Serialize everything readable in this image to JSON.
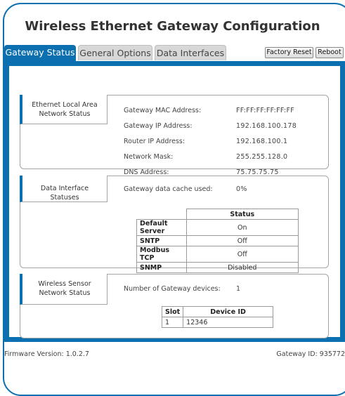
{
  "title": "Wireless Ethernet Gateway Configuration",
  "tabs": [
    {
      "label": "Gateway Status"
    },
    {
      "label": "General Options"
    },
    {
      "label": "Data Interfaces"
    }
  ],
  "buttons": {
    "factory_reset": "Factory Reset",
    "reboot": "Reboot"
  },
  "ethernet": {
    "heading": "Ethernet Local Area Network Status",
    "rows": [
      {
        "label": "Gateway MAC Address:",
        "value": "FF:FF:FF:FF:FF:FF"
      },
      {
        "label": "Gateway IP Address:",
        "value": "192.168.100.178"
      },
      {
        "label": "Router IP Address:",
        "value": "192.168.100.1"
      },
      {
        "label": "Network Mask:",
        "value": "255.255.128.0"
      },
      {
        "label": "DNS Address:",
        "value": "75.75.75.75"
      }
    ]
  },
  "data_interfaces": {
    "heading": "Data Interface Statuses",
    "cache_label": "Gateway data cache used:",
    "cache_value": "0%",
    "status_header": "Status",
    "rows": [
      {
        "name": "Default Server",
        "status": "On"
      },
      {
        "name": "SNTP",
        "status": "Off"
      },
      {
        "name": "Modbus TCP",
        "status": "Off"
      },
      {
        "name": "SNMP",
        "status": "Disabled"
      }
    ]
  },
  "wsn": {
    "heading": "Wireless Sensor Network Status",
    "count_label": "Number of Gateway devices:",
    "count_value": "1",
    "slot_header": "Slot",
    "device_header": "Device ID",
    "rows": [
      {
        "slot": "1",
        "device": "12346"
      }
    ]
  },
  "footer": {
    "firmware": "Firmware Version: 1.0.2.7",
    "gateway_id": "Gateway ID: 935772"
  },
  "colors": {
    "accent": "#0b6fb0"
  }
}
